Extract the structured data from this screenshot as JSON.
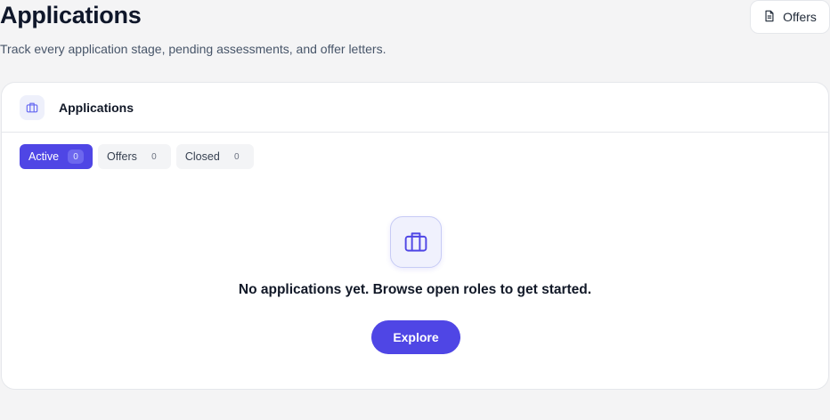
{
  "header": {
    "title": "Applications",
    "subtitle": "Track every application stage, pending assessments, and offer letters.",
    "offers_button": "Offers"
  },
  "card": {
    "title": "Applications",
    "tabs": [
      {
        "label": "Active",
        "count": "0",
        "active": true
      },
      {
        "label": "Offers",
        "count": "0",
        "active": false
      },
      {
        "label": "Closed",
        "count": "0",
        "active": false
      }
    ],
    "empty_state": {
      "message": "No applications yet. Browse open roles to get started.",
      "button": "Explore"
    }
  },
  "colors": {
    "accent": "#4f46e5",
    "background": "#f4f4f5",
    "card": "#ffffff"
  },
  "icons": {
    "offers_button": "document-icon",
    "card_header": "briefcase-icon",
    "empty_state": "briefcase-icon"
  }
}
